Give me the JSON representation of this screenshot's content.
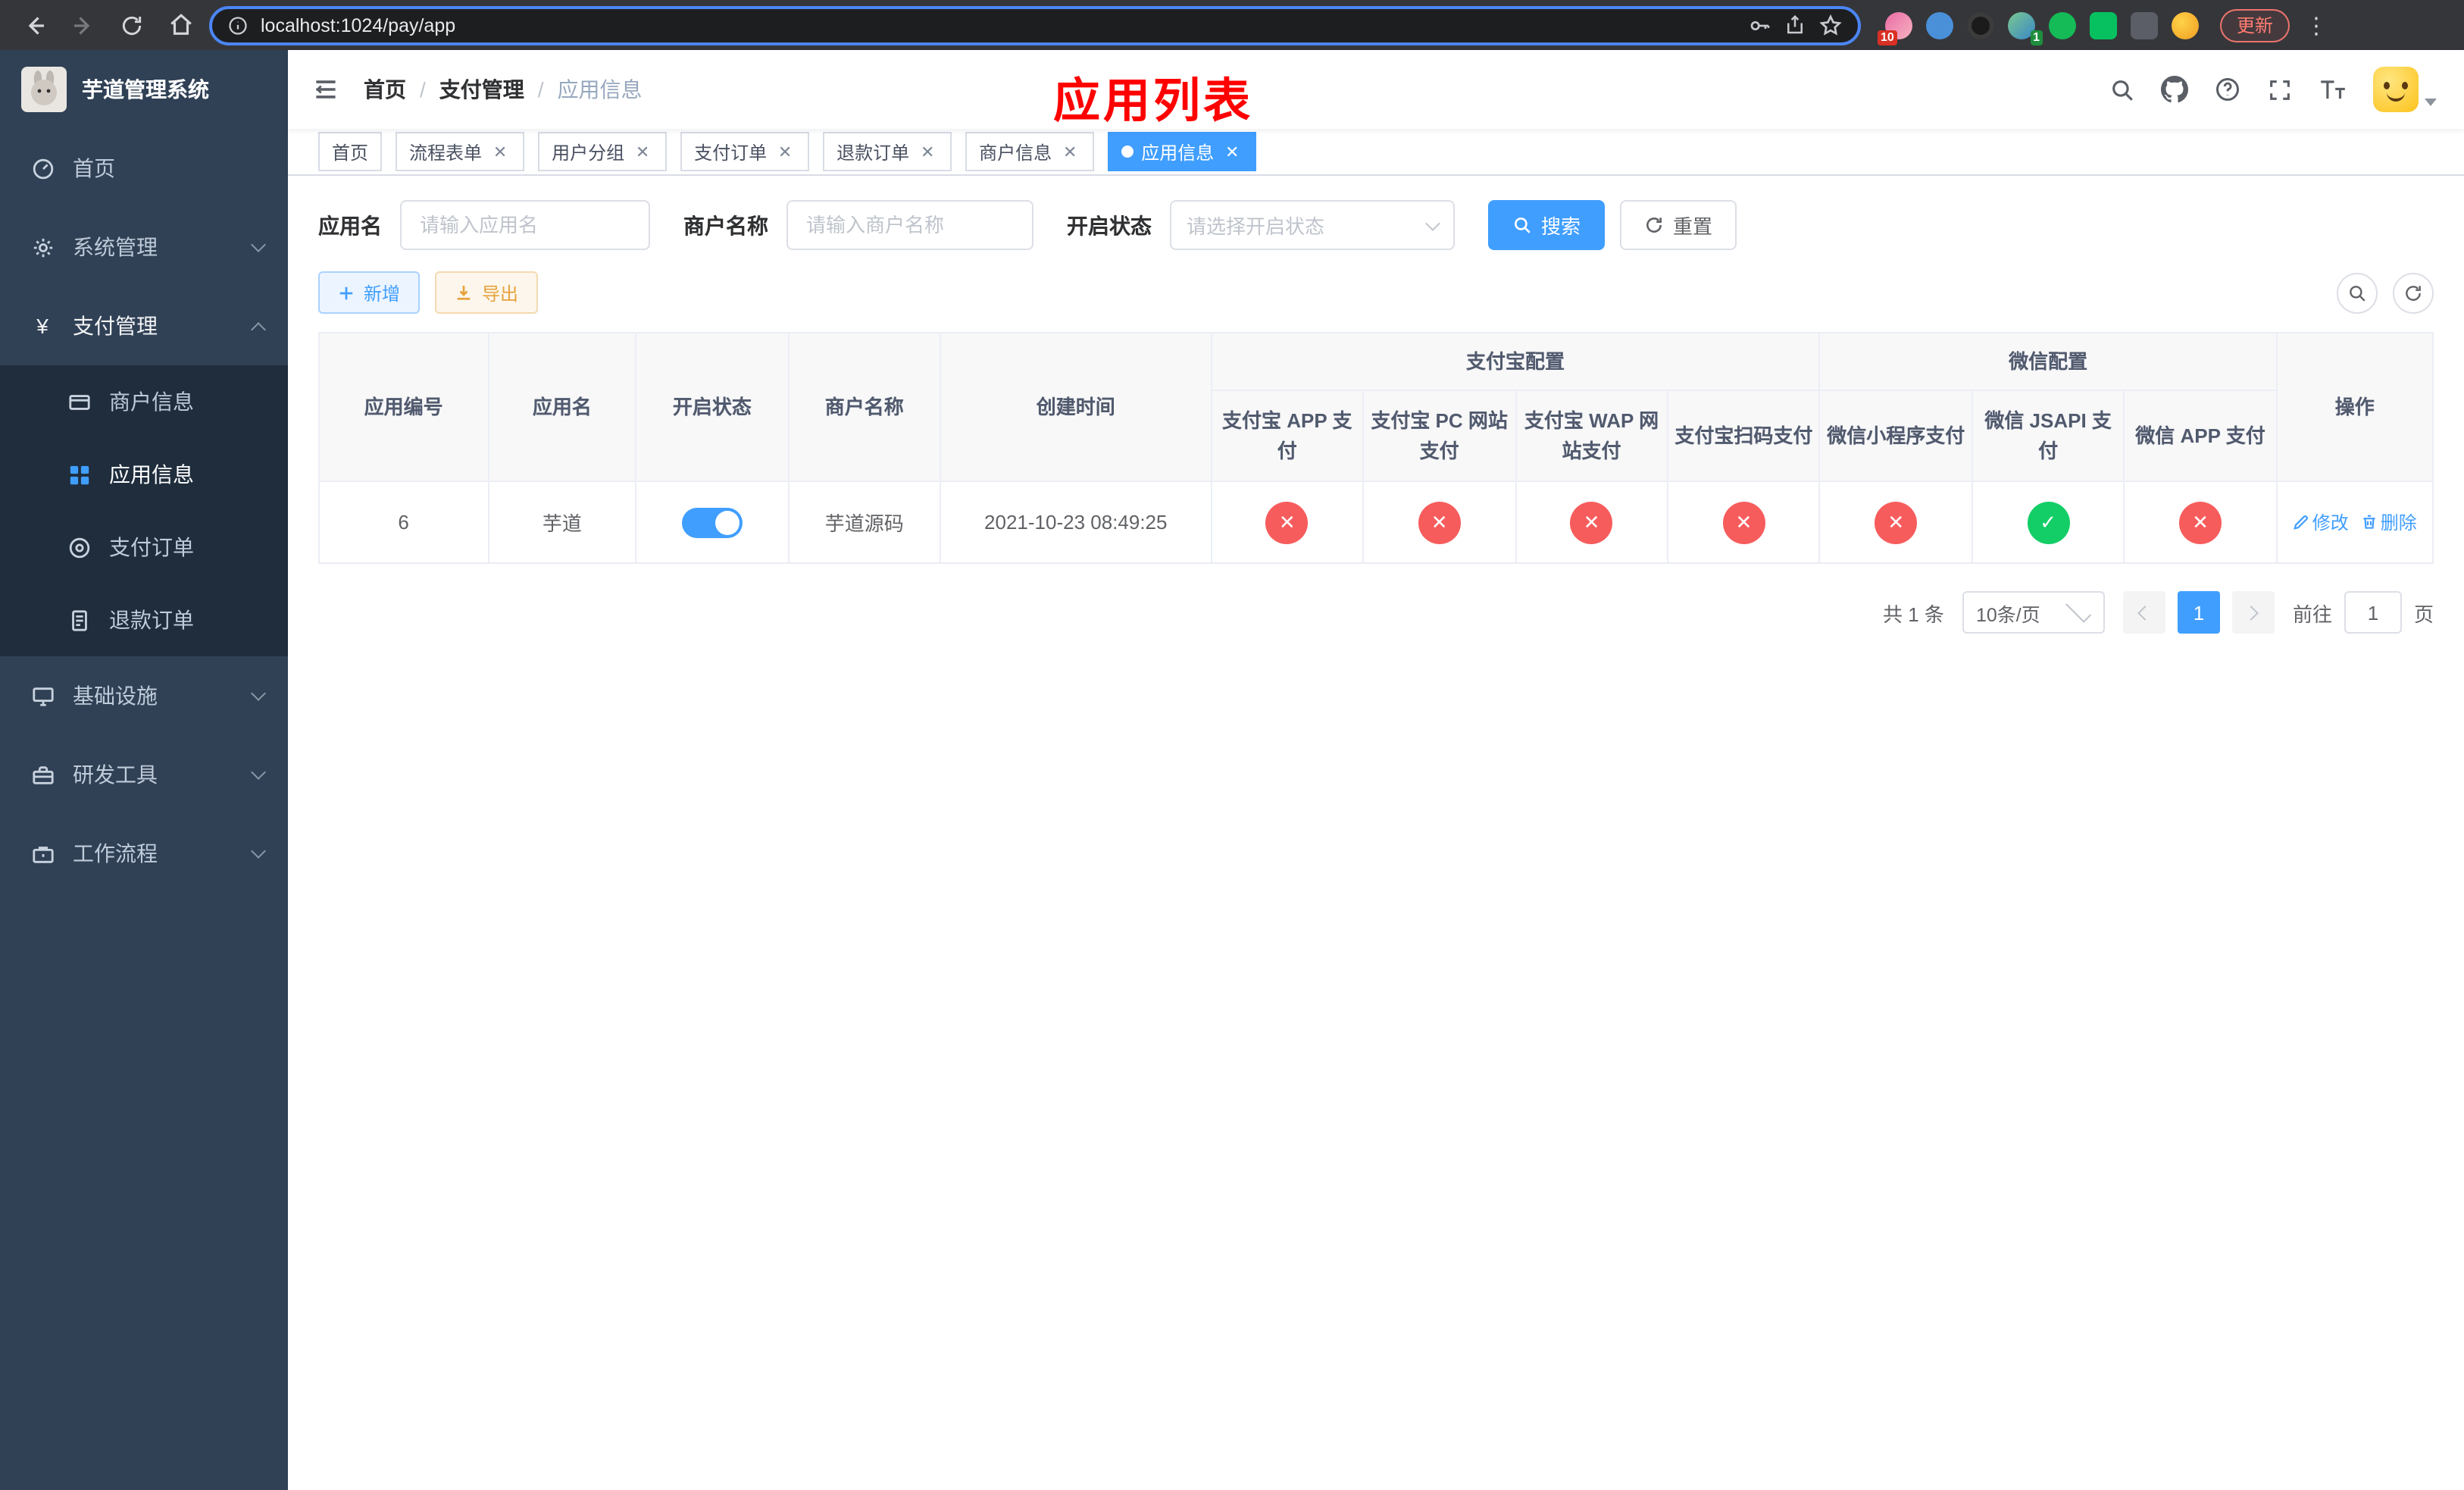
{
  "browser": {
    "url": "localhost:1024/pay/app",
    "update_label": "更新",
    "ext_badge_pin": "10",
    "ext_badge_profile": "1"
  },
  "icons": {
    "close": "✕",
    "check": "✓",
    "cross": "✕",
    "dots": "⋮",
    "yen": "¥",
    "info": "ⓘ"
  },
  "sidebar": {
    "title": "芋道管理系统",
    "home": "首页",
    "system": "系统管理",
    "payment": "支付管理",
    "merchant_info": "商户信息",
    "app_info": "应用信息",
    "pay_order": "支付订单",
    "refund_order": "退款订单",
    "infra": "基础设施",
    "dev_tools": "研发工具",
    "workflow": "工作流程"
  },
  "header": {
    "breadcrumb": [
      "首页",
      "支付管理",
      "应用信息"
    ],
    "overlay_title": "应用列表"
  },
  "tabs": [
    {
      "label": "首页"
    },
    {
      "label": "流程表单"
    },
    {
      "label": "用户分组"
    },
    {
      "label": "支付订单"
    },
    {
      "label": "退款订单"
    },
    {
      "label": "商户信息"
    },
    {
      "label": "应用信息"
    }
  ],
  "filters": {
    "app_name_label": "应用名",
    "app_name_placeholder": "请输入应用名",
    "merchant_label": "商户名称",
    "merchant_placeholder": "请输入商户名称",
    "status_label": "开启状态",
    "status_placeholder": "请选择开启状态",
    "search_label": "搜索",
    "reset_label": "重置"
  },
  "toolbar": {
    "add_label": "新增",
    "export_label": "导出"
  },
  "table": {
    "col_app_id": "应用编号",
    "col_app_name": "应用名",
    "col_status": "开启状态",
    "col_merchant": "商户名称",
    "col_created": "创建时间",
    "group_alipay": "支付宝配置",
    "group_wechat": "微信配置",
    "col_alipay_app": "支付宝 APP 支付",
    "col_alipay_pc": "支付宝 PC 网站支付",
    "col_alipay_wap": "支付宝 WAP 网站支付",
    "col_alipay_qr": "支付宝扫码支付",
    "col_wx_mini": "微信小程序支付",
    "col_wx_jsapi": "微信 JSAPI 支付",
    "col_wx_app": "微信 APP 支付",
    "col_actions": "操作",
    "rows": [
      {
        "id": "6",
        "name": "芋道",
        "status_on": true,
        "merchant": "芋道源码",
        "created": "2021-10-23 08:49:25",
        "channels": [
          "no",
          "no",
          "no",
          "no",
          "no",
          "yes",
          "no"
        ],
        "edit_label": "修改",
        "delete_label": "删除"
      }
    ]
  },
  "pagination": {
    "total": "共 1 条",
    "page_size": "10条/页",
    "page": "1",
    "goto_prefix": "前往",
    "goto_value": "1",
    "goto_suffix": "页"
  },
  "colors": {
    "primary": "#409eff",
    "danger": "#f75c5c",
    "success": "#13ce66",
    "warning": "#e6a23c",
    "sidebar_bg": "#304156",
    "overlay_title": "#fe0000"
  }
}
